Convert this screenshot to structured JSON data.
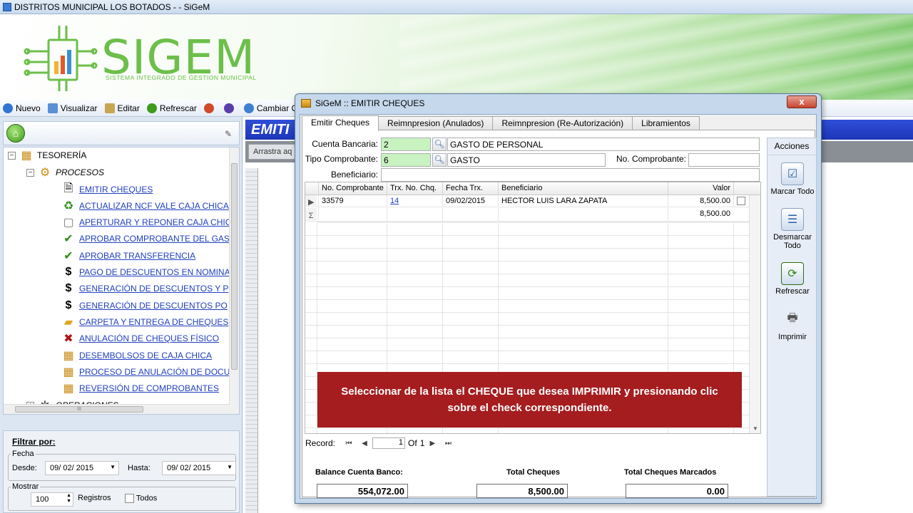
{
  "window": {
    "title": "DISTRITOS MUNICIPAL LOS BOTADOS -  - SiGeM"
  },
  "banner": {
    "logo": "SIGEM",
    "subtitle": "SISTEMA INTEGRADO DE GESTION MUNICIPAL"
  },
  "toolbar": {
    "items": [
      {
        "label": "Nuevo",
        "icon": "plus-circle-icon"
      },
      {
        "label": "Visualizar",
        "icon": "monitor-icon"
      },
      {
        "label": "Editar",
        "icon": "pencil-icon"
      },
      {
        "label": "Refrescar",
        "icon": "refresh-icon"
      },
      {
        "label": "",
        "icon": "tools-icon"
      },
      {
        "label": "",
        "icon": "help-icon"
      },
      {
        "label": "Cambiar Cla",
        "icon": "key-icon"
      }
    ]
  },
  "tree": {
    "root": "TESORERÍA",
    "group": "PROCESOS",
    "items": [
      "EMITIR CHEQUES",
      "ACTUALIZAR NCF VALE CAJA CHICA",
      "APERTURAR Y REPONER CAJA CHIC",
      "APROBAR COMPROBANTE DEL GAST",
      "APROBAR TRANSFERENCIA",
      "PAGO DE DESCUENTOS EN NOMINA",
      "GENERACIÓN DE DESCUENTOS  Y P",
      "GENERACIÓN DE DESCUENTOS  PO",
      "CARPETA Y ENTREGA DE CHEQUES",
      "ANULACIÓN DE CHEQUES FÍSICO",
      "DESEMBOLSOS DE CAJA CHICA",
      "PROCESO DE ANULACIÓN DE DOCU",
      "REVERSIÓN DE COMPROBANTES"
    ],
    "next_group": "OPERACIONES",
    "hscroll_mark": "III"
  },
  "filter": {
    "title": "Filtrar por:",
    "fecha_label": "Fecha",
    "desde_label": "Desde:",
    "desde_value": "09/ 02/ 2015",
    "hasta_label": "Hasta:",
    "hasta_value": "09/ 02/ 2015",
    "mostrar_label": "Mostrar",
    "registros_value": "100",
    "registros_label": "Registros",
    "todos_label": "Todos"
  },
  "background": {
    "header": "EMITI",
    "grouping_text": "Arrastra aq"
  },
  "dialog": {
    "title": "SiGeM :: EMITIR CHEQUES",
    "close": "x",
    "tabs": [
      "Emitir Cheques",
      "Reimnpresion (Anulados)",
      "Reimnpresion (Re-Autorización)",
      "Libramientos"
    ],
    "form": {
      "cuenta_label": "Cuenta Bancaria:",
      "cuenta_code": "2",
      "cuenta_name": "GASTO DE PERSONAL",
      "tipo_label": "Tipo Comprobante:",
      "tipo_code": "6",
      "tipo_name": "GASTO",
      "no_comp_label": "No. Comprobante:",
      "no_comp_value": "",
      "beneficiario_label": "Beneficiario:",
      "beneficiario_value": ""
    },
    "grid": {
      "columns": [
        "No. Comprobante",
        "Trx. No. Chq.",
        "Fecha Trx.",
        "Beneficiario",
        "Valor"
      ],
      "rows": [
        {
          "comprobante": "33579",
          "trx": "14",
          "fecha": "09/02/2015",
          "beneficiario": "HECTOR LUIS LARA ZAPATA",
          "valor": "8,500.00"
        }
      ],
      "sum_symbol": "Σ",
      "sum_valor": "8,500.00"
    },
    "nav": {
      "label": "Record:",
      "current": "1",
      "of": "Of",
      "total": "1"
    },
    "totals": {
      "balance_label": "Balance Cuenta Banco:",
      "balance_value": "554,072.00",
      "cheques_label": "Total Cheques",
      "cheques_value": "8,500.00",
      "marcados_label": "Total Cheques Marcados",
      "marcados_value": "0.00"
    },
    "acciones": {
      "title": "Acciones",
      "buttons": [
        {
          "label": "Marcar Todo",
          "icon": "check-all-icon"
        },
        {
          "label": "Desmarcar Todo",
          "icon": "uncheck-all-icon"
        },
        {
          "label": "Refrescar",
          "icon": "refresh-icon"
        },
        {
          "label": "Imprimir",
          "icon": "printer-icon"
        }
      ]
    }
  },
  "callout": {
    "text": "Seleccionar de la lista el CHEQUE que desea IMPRIMIR y presionando clic sobre el check correspondiente."
  },
  "colors": {
    "accent": "#2f4fd8",
    "callout": "#a51d1f",
    "logo": "#6cbf4a",
    "input_green": "#c8f2c0"
  }
}
